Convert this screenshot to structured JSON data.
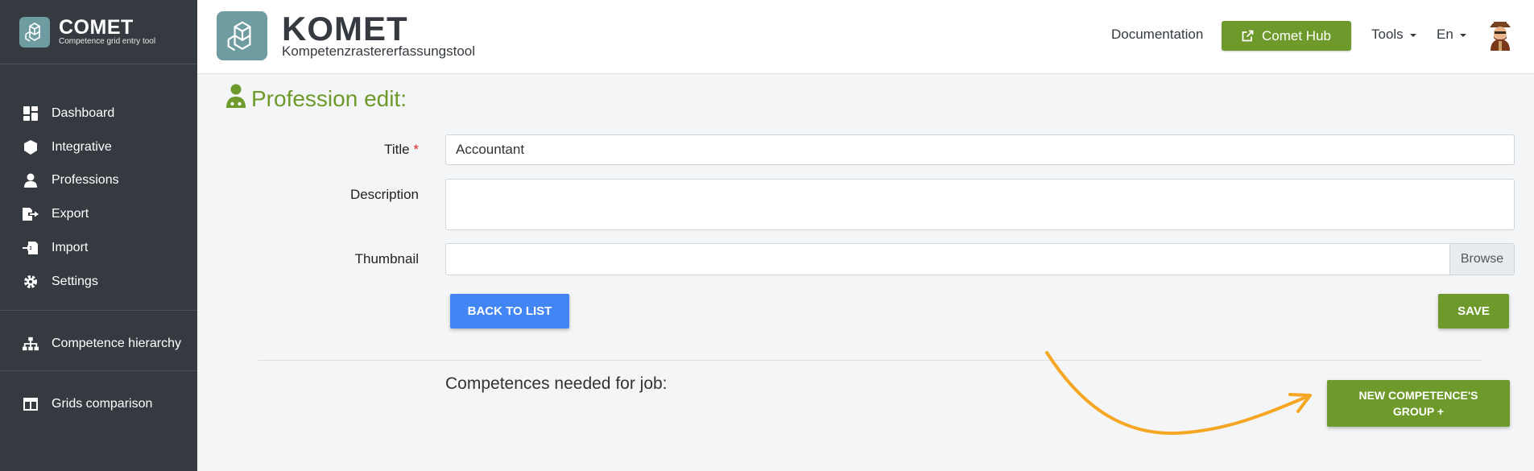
{
  "sidebar": {
    "brand_name": "COMET",
    "brand_sub": "Competence grid entry tool",
    "items": [
      {
        "label": "Dashboard",
        "icon": "dashboard-icon"
      },
      {
        "label": "Integrative",
        "icon": "cube-icon"
      },
      {
        "label": "Professions",
        "icon": "user-doctor-icon"
      },
      {
        "label": "Export",
        "icon": "file-export-icon"
      },
      {
        "label": "Import",
        "icon": "file-import-icon"
      },
      {
        "label": "Settings",
        "icon": "gear-icon"
      },
      {
        "label": "Competence hierarchy",
        "icon": "sitemap-icon"
      },
      {
        "label": "Grids comparison",
        "icon": "columns-icon"
      }
    ]
  },
  "header": {
    "title": "KOMET",
    "subtitle": "Kompetenzrastererfassungstool",
    "documentation": "Documentation",
    "hub_button": "Comet Hub",
    "tools": "Tools",
    "language": "En"
  },
  "main": {
    "page_title": "Profession edit:",
    "title_label": "Title",
    "required_mark": "*",
    "title_value": "Accountant",
    "description_label": "Description",
    "description_value": "",
    "thumbnail_label": "Thumbnail",
    "browse": "Browse",
    "back_button": "BACK TO LIST",
    "save_button": "SAVE",
    "competences_title": "Competences needed for job:",
    "new_group_button": "NEW COMPETENCE'S GROUP  +"
  },
  "colors": {
    "sidebar_bg": "#343a40",
    "accent_green": "#6d9a2a",
    "primary_blue": "#4285f4",
    "annotation_arrow": "#f5a623",
    "logo_teal": "#6f9ca0"
  }
}
